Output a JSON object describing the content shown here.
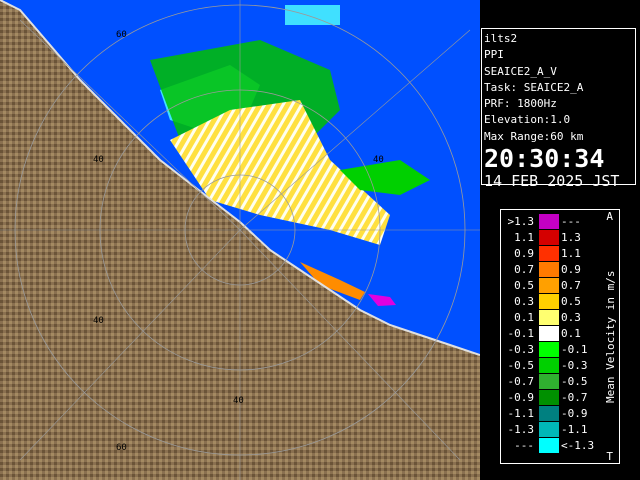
{
  "info": {
    "site": "ilts2",
    "product": "PPI",
    "scan": "SEAICE2_A_V",
    "task": "Task: SEAICE2_A",
    "prf": "PRF: 1800Hz",
    "elevation": "Elevation:1.0",
    "max_range": "Max Range:60 km",
    "time": "20:30:34",
    "date": "14 FEB 2025 JST"
  },
  "legend": {
    "title": "Mean Velocity in m/s",
    "corner_top": "A",
    "corner_bottom": "T",
    "rows": [
      {
        "lo": ">1.3",
        "hi": "---",
        "color": "#c400c4"
      },
      {
        "lo": "1.1",
        "hi": "1.3",
        "color": "#d40000"
      },
      {
        "lo": "0.9",
        "hi": "1.1",
        "color": "#ff3000"
      },
      {
        "lo": "0.7",
        "hi": "0.9",
        "color": "#ff7a00"
      },
      {
        "lo": "0.5",
        "hi": "0.7",
        "color": "#ffa000"
      },
      {
        "lo": "0.3",
        "hi": "0.5",
        "color": "#ffd000"
      },
      {
        "lo": "0.1",
        "hi": "0.3",
        "color": "#ffff70"
      },
      {
        "lo": "-0.1",
        "hi": "0.1",
        "color": "#ffffff"
      },
      {
        "lo": "-0.3",
        "hi": "-0.1",
        "color": "#00ff00"
      },
      {
        "lo": "-0.5",
        "hi": "-0.3",
        "color": "#00d000"
      },
      {
        "lo": "-0.7",
        "hi": "-0.5",
        "color": "#30b030"
      },
      {
        "lo": "-0.9",
        "hi": "-0.7",
        "color": "#009000"
      },
      {
        "lo": "-1.1",
        "hi": "-0.9",
        "color": "#008080"
      },
      {
        "lo": "-1.3",
        "hi": "-1.1",
        "color": "#00b8b8"
      },
      {
        "lo": "---",
        "hi": "<-1.3",
        "color": "#00ffff"
      }
    ]
  },
  "map": {
    "range_labels": [
      "60",
      "40",
      "40",
      "40",
      "40",
      "60"
    ],
    "colors": {
      "sea": "#0050ff",
      "land": "#7a6244",
      "ring": "#9a9a9a"
    }
  }
}
